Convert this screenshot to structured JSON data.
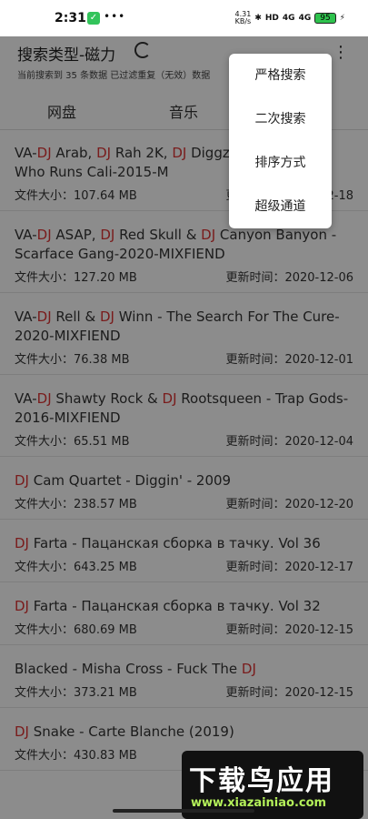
{
  "status": {
    "time": "2:31",
    "speed_top": "4.31",
    "speed_bottom": "KB/s",
    "hd": "HD",
    "sig1": "4G",
    "sig2": "4G",
    "battery": "95"
  },
  "header": {
    "title": "搜索类型-磁力",
    "subtitle": "当前搜索到 35 条数据 已过滤重复（无效）数据"
  },
  "tabs": [
    {
      "label": "网盘"
    },
    {
      "label": "音乐"
    }
  ],
  "menu": {
    "items": [
      "严格搜索",
      "二次搜索",
      "排序方式",
      "超级通道"
    ]
  },
  "labels": {
    "size_prefix": "文件大小：",
    "update_prefix": "更新时间："
  },
  "items": [
    {
      "title_html": "VA-<span class='dj'>DJ</span> Arab, <span class='dj'>DJ</span> Rah 2K, <span class='dj'>DJ</span> Diggz ... Montana - Who Runs Cali-2015-M",
      "size": "107.64 MB",
      "date": "2020-12-18"
    },
    {
      "title_html": "VA-<span class='dj'>DJ</span> ASAP, <span class='dj'>DJ</span> Red Skull &amp; <span class='dj'>DJ</span> Canyon Banyon - Scarface Gang-2020-MIXFIEND",
      "size": "127.20 MB",
      "date": "2020-12-06"
    },
    {
      "title_html": "VA-<span class='dj'>DJ</span> Rell &amp; <span class='dj'>DJ</span> Winn - The Search For The Cure-2020-MIXFIEND",
      "size": "76.38 MB",
      "date": "2020-12-01"
    },
    {
      "title_html": "VA-<span class='dj'>DJ</span> Shawty Rock &amp; <span class='dj'>DJ</span> Rootsqueen - Trap Gods-2016-MIXFIEND",
      "size": "65.51 MB",
      "date": "2020-12-04"
    },
    {
      "title_html": "<span class='dj'>DJ</span> Cam Quartet - Diggin' - 2009",
      "size": "238.57 MB",
      "date": "2020-12-20"
    },
    {
      "title_html": "<span class='dj'>DJ</span> Farta - Пацанская сборка в тачку. Vol 36",
      "size": "643.25 MB",
      "date": "2020-12-17"
    },
    {
      "title_html": "<span class='dj'>DJ</span> Farta - Пацанская сборка в тачку. Vol 32",
      "size": "680.69 MB",
      "date": "2020-12-15"
    },
    {
      "title_html": "Blacked - Misha Cross - Fuck The <span class='dj'>DJ</span>",
      "size": "373.21 MB",
      "date": "2020-12-15"
    },
    {
      "title_html": "<span class='dj'>DJ</span> Snake - Carte Blanche (2019)",
      "size": "430.83 MB",
      "date": ""
    }
  ],
  "watermark": {
    "title": "下载鸟应用",
    "url": "www.xiazainiao.com"
  },
  "colors": {
    "highlight": "#dd3333",
    "battery": "#2ec24d",
    "watermark_url": "#b4f05a"
  }
}
